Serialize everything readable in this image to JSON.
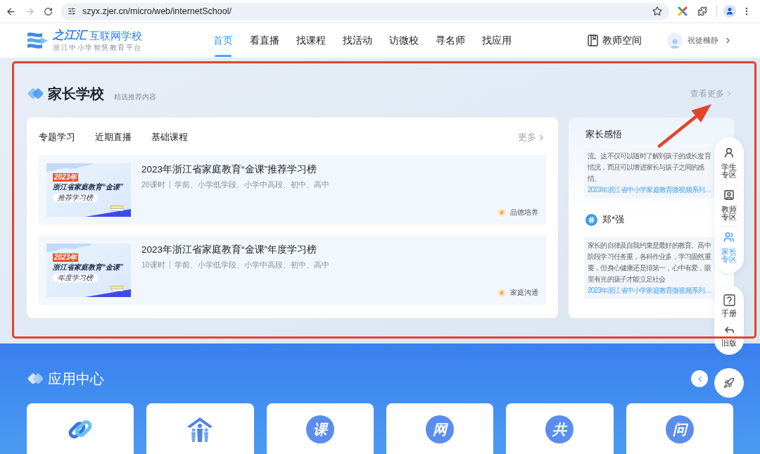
{
  "browser": {
    "url": "szyx.zjer.cn/micro/web/internetSchool/",
    "forward_disabled": true
  },
  "header": {
    "brand": "之江汇",
    "site_name": "互联网学校",
    "tagline": "浙江中小学智慧教育平台",
    "nav": [
      {
        "label": "首页",
        "selected": true
      },
      {
        "label": "看直播",
        "selected": false
      },
      {
        "label": "找课程",
        "selected": false
      },
      {
        "label": "找活动",
        "selected": false
      },
      {
        "label": "访微校",
        "selected": false
      },
      {
        "label": "寻名师",
        "selected": false
      },
      {
        "label": "找应用",
        "selected": false
      }
    ],
    "teacher_space": "教师空间",
    "user_name": "祝徒橼静"
  },
  "parent_school": {
    "title": "家长学校",
    "subtitle": "精选推荐内容",
    "more": "查看更多",
    "tabs": [
      "专题学习",
      "近期直播",
      "基础课程"
    ],
    "tabs_more": "更多",
    "courses": [
      {
        "thumbnail": {
          "year": "2023年",
          "headline": "浙江省家庭教育“金课”",
          "label": "推荐学习榜"
        },
        "title": "2023年浙江省家庭教育“金课”推荐学习榜",
        "hours": "20课时",
        "grades": "学前、小学低学段、小学中高段、初中、高中",
        "tag": "品德培养"
      },
      {
        "thumbnail": {
          "year": "2023年",
          "headline": "浙江省家庭教育“金课”",
          "label": "年度学习榜"
        },
        "title": "2023年浙江省家庭教育“金课”年度学习榜",
        "hours": "10课时",
        "grades": "学前、小学低学段、小学中高段、初中、高中",
        "tag": "家庭沟通"
      }
    ],
    "reflections": {
      "title": "家长感悟",
      "items": [
        {
          "text": "流。这不仅可以随时了解到孩子的成长发育情况，而且可以增进家长与孩子之间的感情。",
          "source": "2023年浙江省中小学家庭教育微视频系列…"
        },
        {
          "author": "郑*强",
          "text": "家长的自律及自我约束是最好的教育。高中阶段学习任务重，各科作业多，学习固然重要，但身心健康还是排第一，心中有爱，眼里有光的孩子才能立足社会",
          "source": "2023年浙江省中小学家庭教育微视频系列…"
        }
      ]
    }
  },
  "side_tools": {
    "zones": [
      {
        "label": "学生专区",
        "selected": false
      },
      {
        "label": "教师专区",
        "selected": false
      },
      {
        "label": "家长专区",
        "selected": true
      }
    ],
    "help": [
      "手册",
      "旧版"
    ]
  },
  "app_center": {
    "title": "应用中心",
    "apps": [
      {
        "kind": "link"
      },
      {
        "kind": "house"
      },
      {
        "kind": "glyph",
        "glyph": "课"
      },
      {
        "kind": "glyph",
        "glyph": "网"
      },
      {
        "kind": "glyph",
        "glyph": "共"
      },
      {
        "kind": "glyph",
        "glyph": "问"
      }
    ]
  }
}
